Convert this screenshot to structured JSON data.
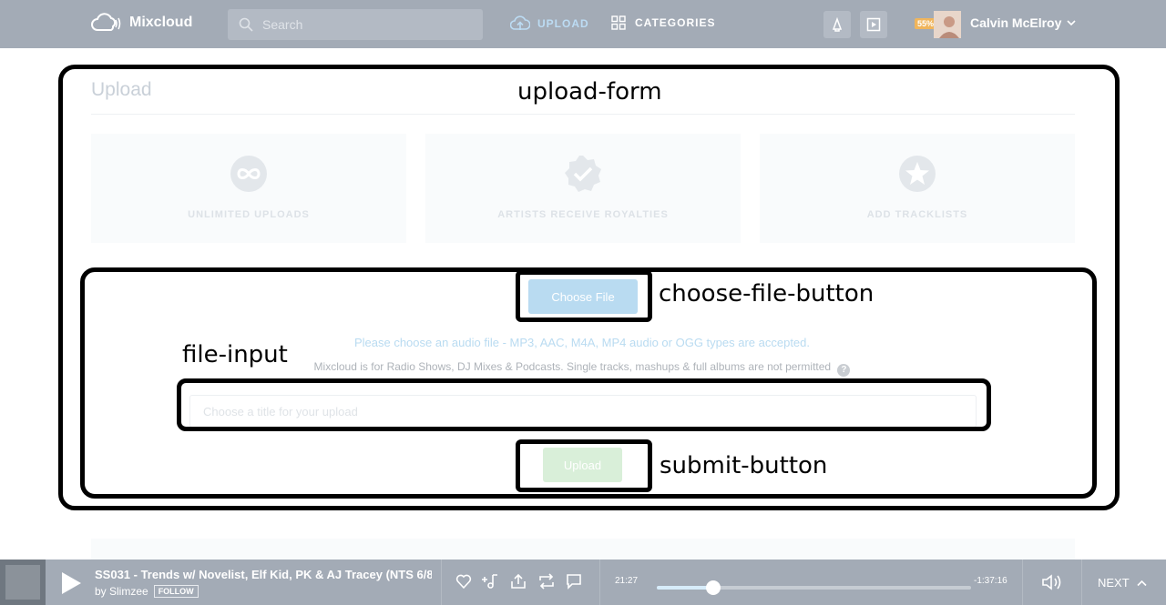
{
  "header": {
    "logo_text": "Mixcloud",
    "search_placeholder": "Search",
    "nav_upload": "UPLOAD",
    "nav_categories": "CATEGORIES",
    "progress_badge": "55%",
    "username": "Calvin McElroy"
  },
  "main": {
    "title": "Upload",
    "features": [
      {
        "label": "UNLIMITED UPLOADS",
        "icon": "infinity-icon"
      },
      {
        "label": "ARTISTS RECEIVE ROYALTIES",
        "icon": "verified-check-icon"
      },
      {
        "label": "ADD TRACKLISTS",
        "icon": "star-icon"
      }
    ],
    "choose_file_label": "Choose File",
    "file_hint": "Please choose an audio file - MP3, AAC, M4A, MP4 audio or OGG types are accepted.",
    "policy_text": "Mixcloud is for Radio Shows, DJ Mixes & Podcasts. Single tracks, mashups & full albums are not permitted",
    "help_mark": "?",
    "title_placeholder": "Choose a title for your upload",
    "submit_label": "Upload"
  },
  "annotations": {
    "upload_form": "upload-form",
    "choose_file_button": "choose-file-button",
    "file_input": "file-input",
    "submit_button": "submit-button"
  },
  "player": {
    "track_title": "SS031 - Trends w/ Novelist, Elf Kid, PK & AJ Tracey (NTS 6/8...",
    "by_text": "by Slimzee",
    "follow_label": "FOLLOW",
    "elapsed": "21:27",
    "remaining": "-1:37:16",
    "progress_fraction": 0.18,
    "next_label": "NEXT"
  },
  "colors": {
    "topbar": "#a3abb6",
    "accent_blue": "#b9dbf1",
    "submit_green": "#d9efd9",
    "badge": "#f0b55c"
  }
}
